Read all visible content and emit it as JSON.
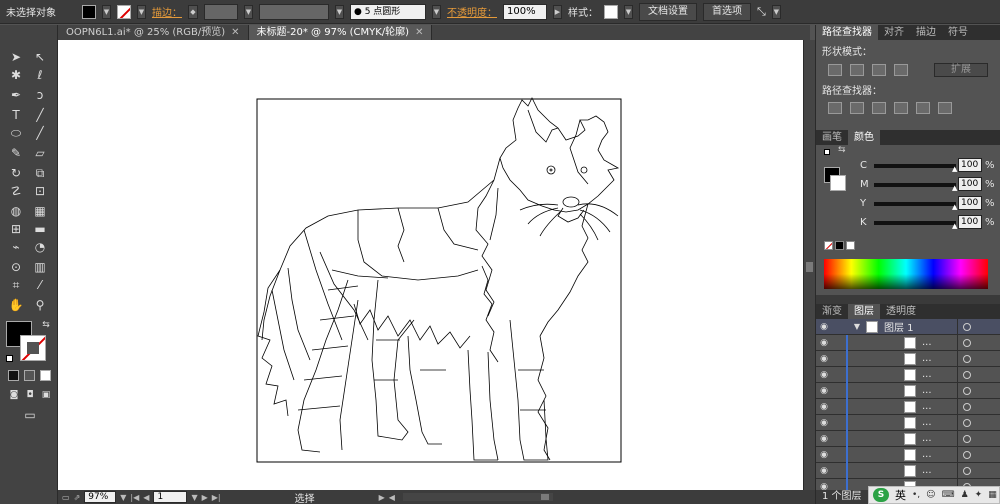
{
  "control_bar": {
    "selection_label": "未选择对象",
    "stroke_label": "描边：",
    "brush_label": "5 点圆形",
    "opacity_label": "不透明度：",
    "opacity_value": "100%",
    "style_label": "样式：",
    "doc_setup": "文档设置",
    "preferences": "首选项"
  },
  "tabs": [
    {
      "label": "OOPN6L1.ai* @ 25% (RGB/预览)"
    },
    {
      "label": "未标题-20* @ 97% (CMYK/轮廓)"
    }
  ],
  "pathfinder": {
    "tabs": [
      "路径查找器",
      "对齐",
      "描边",
      "符号"
    ],
    "shape_modes": "形状模式：",
    "expand": "扩展",
    "pathfinders": "路径查找器："
  },
  "color": {
    "tabs": [
      "画笔",
      "颜色"
    ],
    "channels": [
      {
        "name": "C",
        "value": "100"
      },
      {
        "name": "M",
        "value": "100"
      },
      {
        "name": "Y",
        "value": "100"
      },
      {
        "name": "K",
        "value": "100"
      }
    ],
    "pct": "%"
  },
  "layers": {
    "tabs": [
      "渐变",
      "图层",
      "透明度"
    ],
    "layer_name": "图层 1",
    "sublayer_text": "...",
    "count": "1 个图层"
  },
  "status": {
    "zoom": "97%",
    "page": "1",
    "tool": "选择"
  },
  "ime": {
    "mode": "英"
  },
  "colors": {
    "accent_link": "#e59a3a",
    "panel_bg": "#535353"
  }
}
